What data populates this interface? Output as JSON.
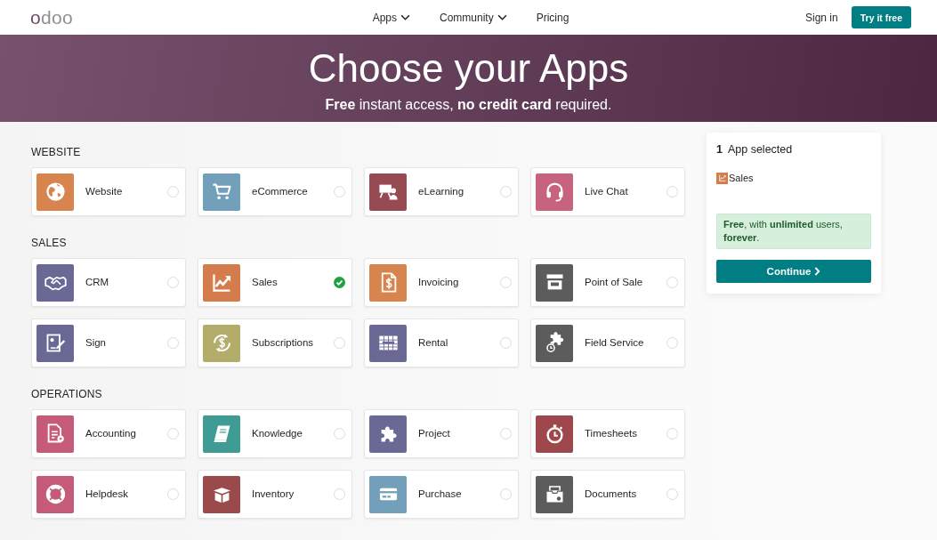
{
  "nav": {
    "logo": "odoo",
    "links": [
      {
        "label": "Apps",
        "dropdown": true
      },
      {
        "label": "Community",
        "dropdown": true
      },
      {
        "label": "Pricing",
        "dropdown": false
      }
    ],
    "sign_in": "Sign in",
    "cta": "Try it free"
  },
  "hero": {
    "title": "Choose your Apps",
    "subtitle": "**Free** instant access, **no credit card** required."
  },
  "sections": [
    {
      "title": "WEBSITE",
      "apps": [
        {
          "name": "Website",
          "kind": "globe",
          "color": "#d8844f",
          "selected": false
        },
        {
          "name": "eCommerce",
          "kind": "cart",
          "color": "#72a0ba",
          "selected": false
        },
        {
          "name": "eLearning",
          "kind": "whiteboard",
          "color": "#974a52",
          "selected": false
        },
        {
          "name": "Live Chat",
          "kind": "headset",
          "color": "#c8637f",
          "selected": false
        }
      ]
    },
    {
      "title": "SALES",
      "apps": [
        {
          "name": "CRM",
          "kind": "handshake",
          "color": "#6a6894",
          "selected": false
        },
        {
          "name": "Sales",
          "kind": "chart",
          "color": "#d47c4c",
          "selected": true
        },
        {
          "name": "Invoicing",
          "kind": "invoice",
          "color": "#d8844f",
          "selected": false
        },
        {
          "name": "Point of Sale",
          "kind": "storefront",
          "color": "#5c5c5c",
          "selected": false
        },
        {
          "name": "Sign",
          "kind": "signing",
          "color": "#6a6894",
          "selected": false
        },
        {
          "name": "Subscriptions",
          "kind": "cycle",
          "color": "#b3ac6a",
          "selected": false
        },
        {
          "name": "Rental",
          "kind": "grid",
          "color": "#6a6894",
          "selected": false
        },
        {
          "name": "Field Service",
          "kind": "puzzleclock",
          "color": "#5c5c5c",
          "selected": false
        }
      ]
    },
    {
      "title": "OPERATIONS",
      "apps": [
        {
          "name": "Accounting",
          "kind": "sheet",
          "color": "#c65a79",
          "selected": false
        },
        {
          "name": "Knowledge",
          "kind": "book",
          "color": "#3f9c95",
          "selected": false
        },
        {
          "name": "Project",
          "kind": "puzzle",
          "color": "#6a6894",
          "selected": false
        },
        {
          "name": "Timesheets",
          "kind": "stopwatch",
          "color": "#9e474c",
          "selected": false
        },
        {
          "name": "Helpdesk",
          "kind": "lifebuoy",
          "color": "#c65a79",
          "selected": false
        },
        {
          "name": "Inventory",
          "kind": "box",
          "color": "#9a4a4b",
          "selected": false
        },
        {
          "name": "Purchase",
          "kind": "card",
          "color": "#72a0ba",
          "selected": false
        },
        {
          "name": "Documents",
          "kind": "tray",
          "color": "#5c5c5c",
          "selected": false
        }
      ]
    }
  ],
  "summary": {
    "count": "1",
    "title": "App selected",
    "selected_apps": [
      {
        "name": "Sales",
        "kind": "chart",
        "color": "#d47c4c"
      }
    ],
    "notice": "**Free**, with **unlimited** users, **forever**.",
    "button": "Continue"
  }
}
